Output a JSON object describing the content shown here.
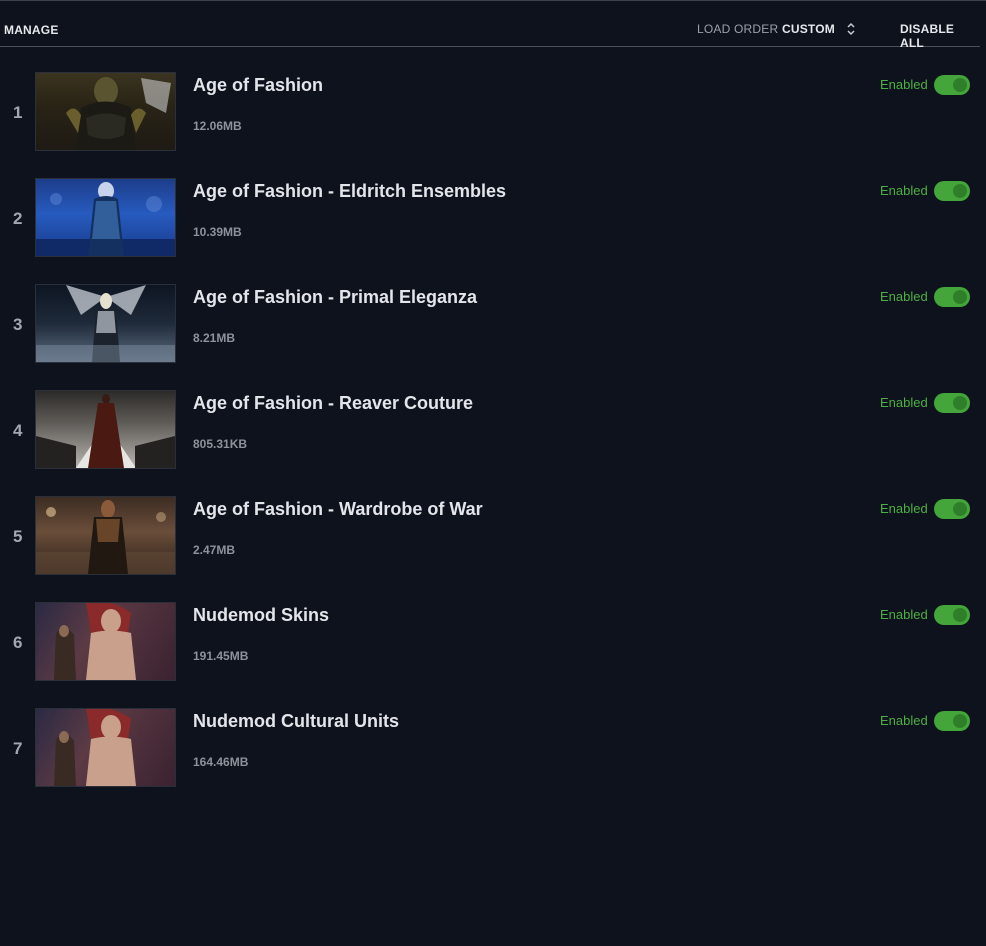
{
  "header": {
    "title": "MANAGE",
    "load_order_label": "LOAD ORDER",
    "load_order_value": "CUSTOM",
    "disable_all_label": "DISABLE ALL"
  },
  "mods": [
    {
      "index": "1",
      "name": "Age of Fashion",
      "size": "12.06MB",
      "status": "Enabled",
      "enabled": true
    },
    {
      "index": "2",
      "name": "Age of Fashion - Eldritch Ensembles",
      "size": "10.39MB",
      "status": "Enabled",
      "enabled": true
    },
    {
      "index": "3",
      "name": "Age of Fashion - Primal Eleganza",
      "size": "8.21MB",
      "status": "Enabled",
      "enabled": true
    },
    {
      "index": "4",
      "name": "Age of Fashion - Reaver Couture",
      "size": "805.31KB",
      "status": "Enabled",
      "enabled": true
    },
    {
      "index": "5",
      "name": "Age of Fashion - Wardrobe of War",
      "size": "2.47MB",
      "status": "Enabled",
      "enabled": true
    },
    {
      "index": "6",
      "name": "Nudemod Skins",
      "size": "191.45MB",
      "status": "Enabled",
      "enabled": true
    },
    {
      "index": "7",
      "name": "Nudemod Cultural Units",
      "size": "164.46MB",
      "status": "Enabled",
      "enabled": true
    }
  ],
  "colors": {
    "background": "#0e121c",
    "enabled_text": "#4bb043",
    "toggle_on": "#43a53a"
  },
  "icons": {
    "sort": "sort-updown-icon"
  }
}
